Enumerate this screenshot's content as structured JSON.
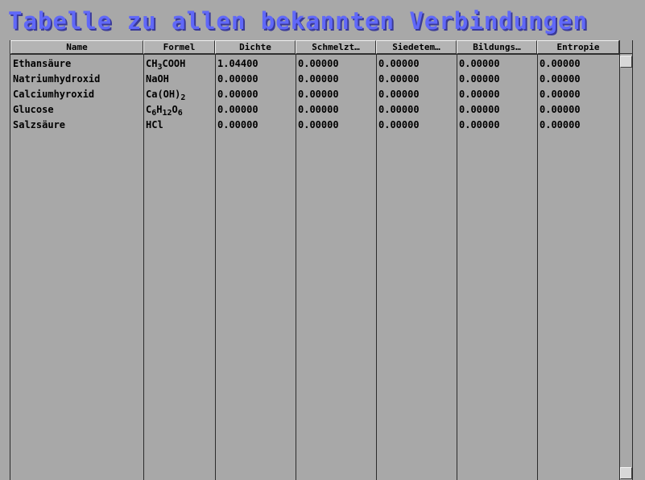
{
  "title": "Tabelle zu allen bekannten Verbindungen",
  "columns": [
    "Name",
    "Formel",
    "Dichte",
    "Schmelzt…",
    "Siedetem…",
    "Bildungs…",
    "Entropie"
  ],
  "rows": [
    {
      "name": "Ethansäure",
      "formula": [
        [
          "CH",
          "3"
        ],
        [
          "COOH",
          ""
        ]
      ],
      "dichte": "1.04400",
      "schmelz": "0.00000",
      "siede": "0.00000",
      "bildung": "0.00000",
      "entropie": "0.00000"
    },
    {
      "name": "Natriumhydroxid",
      "formula": [
        [
          "NaOH",
          ""
        ]
      ],
      "dichte": "0.00000",
      "schmelz": "0.00000",
      "siede": "0.00000",
      "bildung": "0.00000",
      "entropie": "0.00000"
    },
    {
      "name": "Calciumhyroxid",
      "formula": [
        [
          "Ca(OH)",
          "2"
        ]
      ],
      "dichte": "0.00000",
      "schmelz": "0.00000",
      "siede": "0.00000",
      "bildung": "0.00000",
      "entropie": "0.00000"
    },
    {
      "name": "Glucose",
      "formula": [
        [
          "C",
          "6"
        ],
        [
          "H",
          "12"
        ],
        [
          "O",
          "6"
        ]
      ],
      "dichte": "0.00000",
      "schmelz": "0.00000",
      "siede": "0.00000",
      "bildung": "0.00000",
      "entropie": "0.00000"
    },
    {
      "name": "Salzsäure",
      "formula": [
        [
          "HCl",
          ""
        ]
      ],
      "dichte": "0.00000",
      "schmelz": "0.00000",
      "siede": "0.00000",
      "bildung": "0.00000",
      "entropie": "0.00000"
    }
  ],
  "colors": {
    "title": "#6068f8",
    "background": "#a8a8a8"
  }
}
